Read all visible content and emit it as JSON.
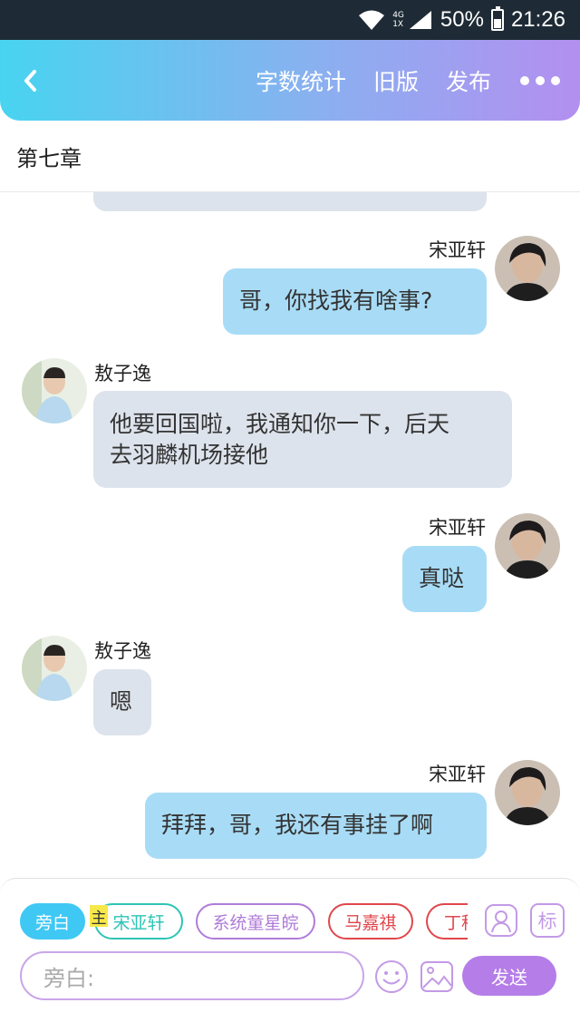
{
  "status_bar": {
    "network_top": "4G",
    "network_bottom": "1X",
    "battery": "50%",
    "time": "21:26"
  },
  "header": {
    "actions": [
      "字数统计",
      "旧版",
      "发布"
    ]
  },
  "chapter_title": "第七章",
  "messages": [
    {
      "side": "right",
      "name": "宋亚轩",
      "lines": [
        "哥，你找我有啥事?"
      ]
    },
    {
      "side": "left",
      "name": "敖子逸",
      "lines": [
        "他要回国啦，我通知你一下，后天",
        "去羽麟机场接他"
      ]
    },
    {
      "side": "right",
      "name": "宋亚轩",
      "lines": [
        "真哒"
      ]
    },
    {
      "side": "left",
      "name": "敖子逸",
      "lines": [
        "嗯"
      ]
    },
    {
      "side": "right",
      "name": "宋亚轩",
      "lines": [
        "拜拜，哥，我还有事挂了啊"
      ]
    }
  ],
  "composer": {
    "roles": [
      {
        "label": "旁白",
        "color": "#3fc8f4"
      },
      {
        "label": "宋亚轩",
        "color": "#2ec4b6"
      },
      {
        "label": "系统童星皖",
        "color": "#b07cd8"
      },
      {
        "label": "马嘉祺",
        "color": "#e0474c"
      },
      {
        "label": "丁程",
        "color": "#e0474c"
      }
    ],
    "main_tag": "主",
    "tag_button": "标",
    "input_placeholder": "旁白:",
    "send_label": "发送"
  }
}
